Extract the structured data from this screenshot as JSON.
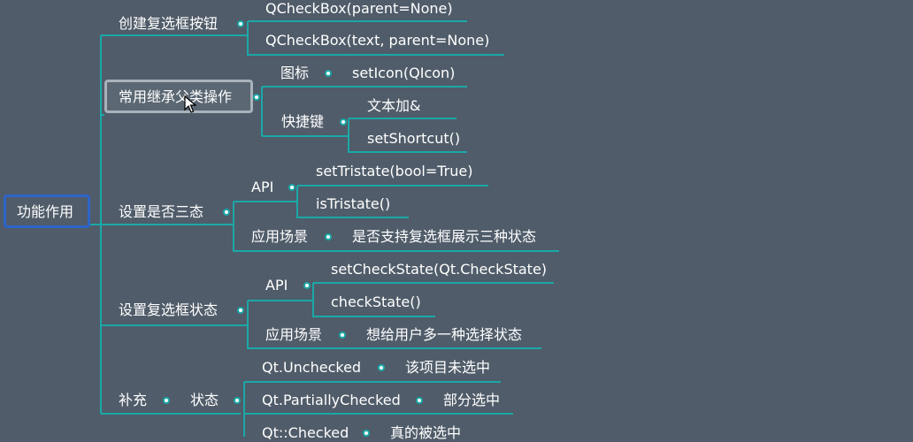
{
  "root": {
    "label": "功能作用"
  },
  "branches": {
    "create": {
      "label": "创建复选框按钮",
      "items": [
        "QCheckBox(parent=None)",
        "QCheckBox(text, parent=None)"
      ]
    },
    "inherit": {
      "label": "常用继承父类操作",
      "icon": {
        "label": "图标",
        "value": "setIcon(QIcon)"
      },
      "shortcut": {
        "label": "快捷键",
        "items": [
          "文本加&",
          "setShortcut()"
        ]
      }
    },
    "tristate": {
      "label": "设置是否三态",
      "api": {
        "label": "API",
        "items": [
          "setTristate(bool=True)",
          "isTristate()"
        ]
      },
      "scene": {
        "label": "应用场景",
        "value": "是否支持复选框展示三种状态"
      }
    },
    "checkstate": {
      "label": "设置复选框状态",
      "api": {
        "label": "API",
        "items": [
          "setCheckState(Qt.CheckState)",
          "checkState()"
        ]
      },
      "scene": {
        "label": "应用场景",
        "value": "想给用户多一种选择状态"
      }
    },
    "supplement": {
      "label": "补充",
      "state": {
        "label": "状态",
        "items": [
          {
            "key": "Qt.Unchecked",
            "desc": "该项目未选中"
          },
          {
            "key": "Qt.PartiallyChecked",
            "desc": "部分选中"
          },
          {
            "key": "Qt::Checked",
            "desc": "真的被选中"
          }
        ]
      }
    }
  },
  "colors": {
    "background": "#505c69",
    "connector": "#1aa8a8",
    "root_border": "#2d64c8",
    "selected_border": "#a9b2bb"
  }
}
